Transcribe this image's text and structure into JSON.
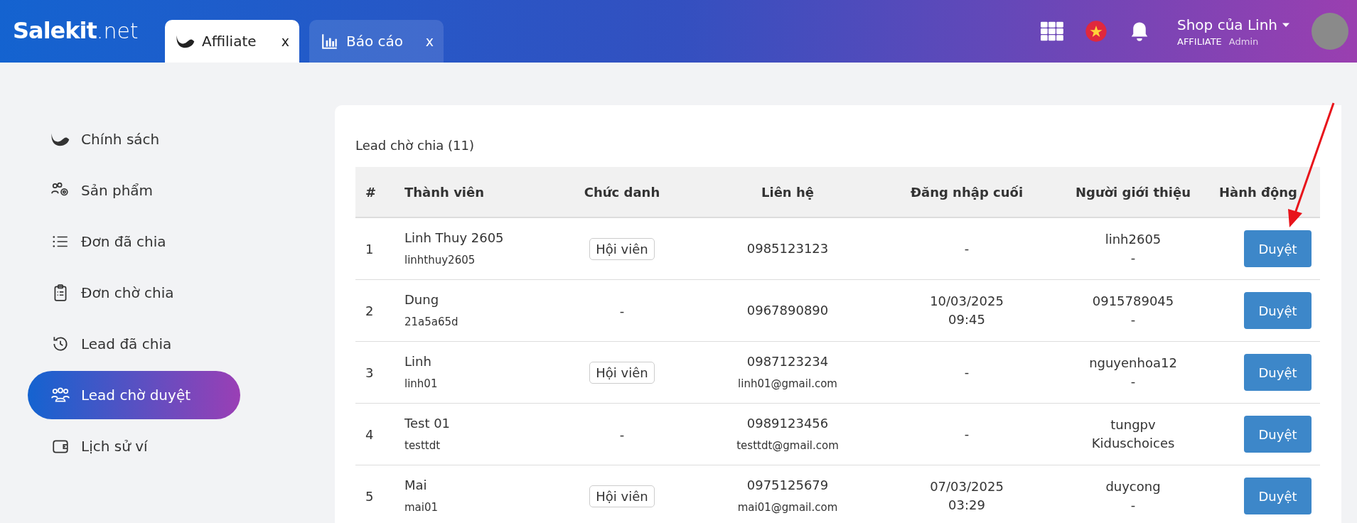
{
  "header": {
    "logo": {
      "brand": "Salekit",
      "suffix": ".net"
    },
    "tabs": [
      {
        "label": "Affiliate",
        "close": "x",
        "selected": true
      },
      {
        "label": "Báo cáo",
        "close": "x",
        "selected": false
      }
    ],
    "user": {
      "name": "Shop của Linh",
      "role": "AFFILIATE",
      "level": "Admin"
    }
  },
  "sidebar": {
    "items": [
      {
        "label": "Chính sách",
        "selected": false
      },
      {
        "label": "Sản phẩm",
        "selected": false
      },
      {
        "label": "Đơn đã chia",
        "selected": false
      },
      {
        "label": "Đơn chờ chia",
        "selected": false
      },
      {
        "label": "Lead đã chia",
        "selected": false
      },
      {
        "label": "Lead chờ duyệt",
        "selected": true
      },
      {
        "label": "Lịch sử ví",
        "selected": false
      }
    ]
  },
  "panel": {
    "title": "Lead chờ chia (11)",
    "columns": [
      "#",
      "Thành viên",
      "Chức danh",
      "Liên hệ",
      "Đăng nhập cuối",
      "Người giới thiệu",
      "Hành động"
    ],
    "rows": [
      {
        "index": "1",
        "name": "Linh Thuy 2605",
        "username": "linhthuy2605",
        "position": {
          "kind": "badge",
          "text": "Hội viên"
        },
        "phone": "0985123123",
        "email": "",
        "last_login": [
          "-"
        ],
        "referrer": [
          "linh2605",
          "-"
        ],
        "action": "Duyệt"
      },
      {
        "index": "2",
        "name": "Dung",
        "username": "21a5a65d",
        "position": {
          "kind": "text",
          "text": "-"
        },
        "phone": "0967890890",
        "email": "",
        "last_login": [
          "10/03/2025",
          "09:45"
        ],
        "referrer": [
          "0915789045",
          "-"
        ],
        "action": "Duyệt"
      },
      {
        "index": "3",
        "name": "Linh",
        "username": "linh01",
        "position": {
          "kind": "badge",
          "text": "Hội viên"
        },
        "phone": "0987123234",
        "email": "linh01@gmail.com",
        "last_login": [
          "-"
        ],
        "referrer": [
          "nguyenhoa12",
          "-"
        ],
        "action": "Duyệt"
      },
      {
        "index": "4",
        "name": "Test 01",
        "username": "testtdt",
        "position": {
          "kind": "text",
          "text": "-"
        },
        "phone": "0989123456",
        "email": "testtdt@gmail.com",
        "last_login": [
          "-"
        ],
        "referrer": [
          "tungpv",
          "Kiduschoices"
        ],
        "action": "Duyệt"
      },
      {
        "index": "5",
        "name": "Mai",
        "username": "mai01",
        "position": {
          "kind": "badge",
          "text": "Hội viên"
        },
        "phone": "0975125679",
        "email": "mai01@gmail.com",
        "last_login": [
          "07/03/2025",
          "03:29"
        ],
        "referrer": [
          "duycong",
          "-"
        ],
        "action": "Duyệt"
      }
    ]
  }
}
